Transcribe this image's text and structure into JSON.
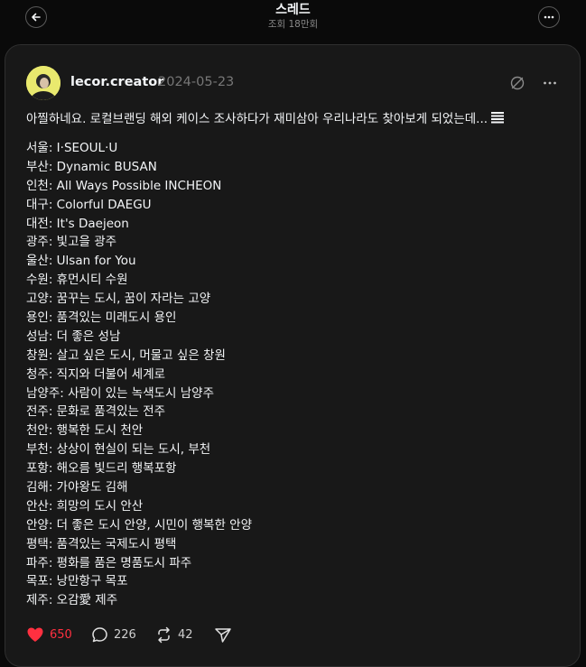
{
  "header": {
    "title": "스레드",
    "views": "조회 18만회"
  },
  "post": {
    "username": "lecor.creator",
    "date": "2024-05-23",
    "intro": "아찔하네요. 로컬브랜딩 해외 케이스 조사하다가 재미삼아 우리나라도 찾아보게 되었는데...",
    "lines": [
      "서울: I·SEOUL·U",
      "부산: Dynamic BUSAN",
      "인천: All Ways Possible INCHEON",
      "대구: Colorful DAEGU",
      "대전: It's Daejeon",
      "광주: 빛고을 광주",
      "울산: Ulsan for You",
      "수원: 휴먼시티 수원",
      "고양: 꿈꾸는 도시, 꿈이 자라는 고양",
      "용인: 품격있는 미래도시 용인",
      "성남: 더 좋은 성남",
      "창원: 살고 싶은 도시, 머물고 싶은 창원",
      "청주: 직지와 더불어 세계로",
      "남양주: 사람이 있는 녹색도시 남양주",
      "전주: 문화로 품격있는 전주",
      "천안: 행복한 도시 천안",
      "부천: 상상이 현실이 되는 도시, 부천",
      "포항: 해오름 빛드리 행복포항",
      "김해: 가야왕도 김해",
      "안산: 희망의 도시 안산",
      "안양: 더 좋은 도시 안양, 시민이 행복한 안양",
      "평택: 품격있는 국제도시 평택",
      "파주: 평화를 품은 명품도시 파주",
      "목포: 낭만항구 목포",
      "제주: 오감愛 제주"
    ]
  },
  "actions": {
    "likes": "650",
    "replies": "226",
    "reposts": "42"
  },
  "colors": {
    "like_active": "#ff3040",
    "background": "#0a0a0a",
    "card": "#181818"
  }
}
